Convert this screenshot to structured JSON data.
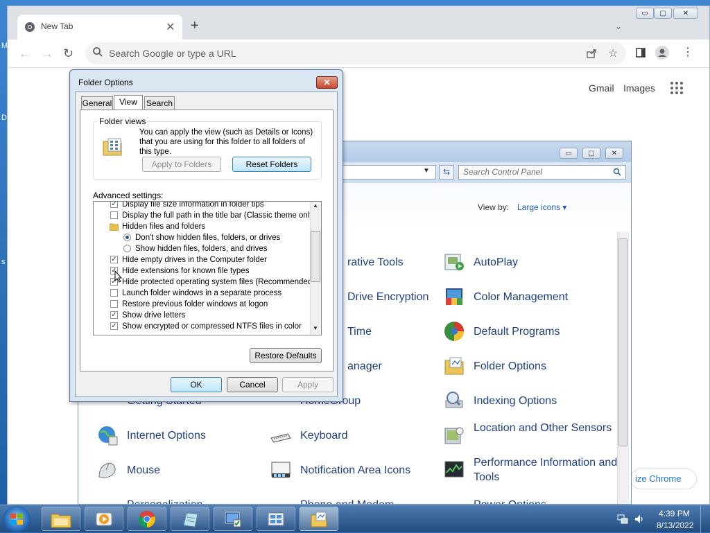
{
  "desktop": {
    "edge_letters": [
      "M",
      "D",
      "s"
    ]
  },
  "chrome": {
    "tab_title": "New Tab",
    "tab_close": "✕",
    "new_tab": "+",
    "tab_search": "⌄",
    "window_min": "▭",
    "window_max": "▢",
    "window_close": "✕",
    "back": "←",
    "forward": "→",
    "reload": "↻",
    "omnibox_placeholder": "Search Google or type a URL",
    "gmail": "Gmail",
    "images": "Images",
    "customize": "ize Chrome"
  },
  "control_panel": {
    "search_placeholder": "Search Control Panel",
    "view_by_label": "View by:",
    "view_by_value": "Large icons ▾",
    "items": [
      {
        "label": "rative Tools",
        "icon": "admin-tools-icon"
      },
      {
        "label": "AutoPlay",
        "icon": "autoplay-icon"
      },
      {
        "label": "Drive Encryption",
        "icon": "bitlocker-icon"
      },
      {
        "label": "Color Management",
        "icon": "color-management-icon"
      },
      {
        "label": "Time",
        "icon": "date-time-icon"
      },
      {
        "label": "Default Programs",
        "icon": "default-programs-icon"
      },
      {
        "label": "anager",
        "icon": "device-manager-icon"
      },
      {
        "label": "Folder Options",
        "icon": "folder-options-icon"
      },
      {
        "label": "Getting Started",
        "icon": "getting-started-icon"
      },
      {
        "label": "HomeGroup",
        "icon": "homegroup-icon"
      },
      {
        "label": "Indexing Options",
        "icon": "indexing-options-icon"
      },
      {
        "label": "Internet Options",
        "icon": "internet-options-icon"
      },
      {
        "label": "Keyboard",
        "icon": "keyboard-icon"
      },
      {
        "label": "Location and Other Sensors",
        "icon": "location-sensors-icon"
      },
      {
        "label": "Mouse",
        "icon": "mouse-icon"
      },
      {
        "label": "Notification Area Icons",
        "icon": "notification-area-icon"
      },
      {
        "label": "Performance Information and Tools",
        "icon": "performance-icon"
      },
      {
        "label": "Personalization",
        "icon": "personalization-icon"
      },
      {
        "label": "Phone and Modem",
        "icon": "phone-modem-icon"
      },
      {
        "label": "Power Options",
        "icon": "power-options-icon"
      }
    ]
  },
  "folder_options": {
    "title": "Folder Options",
    "close": "✕",
    "tabs": [
      "General",
      "View",
      "Search"
    ],
    "active_tab": "View",
    "folder_views_label": "Folder views",
    "folder_views_text": "You can apply the view (such as Details or Icons) that you are using for this folder to all folders of this type.",
    "apply_to_folders": "Apply to Folders",
    "reset_folders": "Reset Folders",
    "advanced_label": "Advanced settings:",
    "settings": [
      {
        "type": "checkbox",
        "label": "Display file size information in folder tips",
        "checked": true
      },
      {
        "type": "checkbox",
        "label": "Display the full path in the title bar (Classic theme only)",
        "checked": false
      },
      {
        "type": "folder",
        "label": "Hidden files and folders"
      },
      {
        "type": "radio",
        "label": "Don't show hidden files, folders, or drives",
        "checked": true
      },
      {
        "type": "radio",
        "label": "Show hidden files, folders, and drives",
        "checked": false
      },
      {
        "type": "checkbox",
        "label": "Hide empty drives in the Computer folder",
        "checked": true
      },
      {
        "type": "checkbox",
        "label": "Hide extensions for known file types",
        "checked": true
      },
      {
        "type": "checkbox",
        "label": "Hide protected operating system files (Recommended)",
        "checked": true
      },
      {
        "type": "checkbox",
        "label": "Launch folder windows in a separate process",
        "checked": false
      },
      {
        "type": "checkbox",
        "label": "Restore previous folder windows at logon",
        "checked": false
      },
      {
        "type": "checkbox",
        "label": "Show drive letters",
        "checked": true
      },
      {
        "type": "checkbox",
        "label": "Show encrypted or compressed NTFS files in color",
        "checked": true
      }
    ],
    "restore_defaults": "Restore Defaults",
    "ok": "OK",
    "cancel": "Cancel",
    "apply": "Apply"
  },
  "taskbar": {
    "apps": [
      "windows-explorer-icon",
      "media-player-icon",
      "chrome-icon",
      "notepad-icon",
      "action-center-icon",
      "control-panel-icon",
      "folder-options-icon"
    ],
    "time": "4:39 PM",
    "date": "8/13/2022"
  }
}
